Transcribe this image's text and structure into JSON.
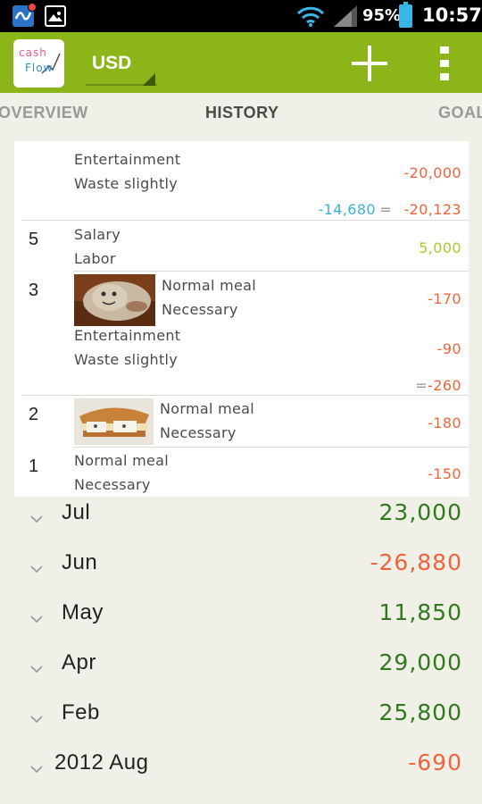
{
  "status_bar": {
    "battery_percent": "95%",
    "time": "10:57",
    "icons": [
      "app-notification-icon",
      "gallery-icon",
      "wifi-icon",
      "signal-icon",
      "battery-icon"
    ]
  },
  "action_bar": {
    "logo_line1": "cash",
    "logo_line2": "Flow",
    "currency": "USD",
    "add_icon": "plus-icon",
    "overflow_icon": "overflow-menu-icon",
    "color": "#8cb51a"
  },
  "tabs": [
    {
      "label": "OVERVIEW",
      "active": false
    },
    {
      "label": "HISTORY",
      "active": true
    },
    {
      "label": "GOAL",
      "active": false
    }
  ],
  "history": {
    "top_group": {
      "entry": {
        "category": "Entertainment",
        "type": "Waste slightly",
        "amount": "-20,000"
      },
      "summary_left": "-14,680",
      "summary_sep": "=",
      "summary_total": "-20,123"
    },
    "days": [
      {
        "day": "5",
        "entries": [
          {
            "category": "Salary",
            "type": "Labor",
            "amount": "5,000"
          }
        ]
      },
      {
        "day": "3",
        "entries": [
          {
            "category": "Normal meal",
            "type": "Necessary",
            "amount": "-170",
            "photo": "food-plate-photo"
          },
          {
            "category": "Entertainment",
            "type": "Waste slightly",
            "amount": "-90"
          }
        ],
        "summary_sep": "=",
        "summary_total": "-260"
      },
      {
        "day": "2",
        "entries": [
          {
            "category": "Normal meal",
            "type": "Necessary",
            "amount": "-180",
            "photo": "sandwich-photo"
          }
        ]
      },
      {
        "day": "1",
        "entries": [
          {
            "category": "Normal meal",
            "type": "Necessary",
            "amount": "-150"
          }
        ]
      }
    ]
  },
  "months": [
    {
      "label": "Jul",
      "value": "23,000",
      "color": "#2f7a1b"
    },
    {
      "label": "Jun",
      "value": "-26,880",
      "color": "#f0643a"
    },
    {
      "label": "May",
      "value": "11,850",
      "color": "#2f7a1b"
    },
    {
      "label": "Apr",
      "value": "29,000",
      "color": "#2f7a1b"
    },
    {
      "label": "Feb",
      "value": "25,800",
      "color": "#2f7a1b"
    },
    {
      "label": "2012 Aug",
      "value": "-690",
      "color": "#f0643a"
    }
  ]
}
